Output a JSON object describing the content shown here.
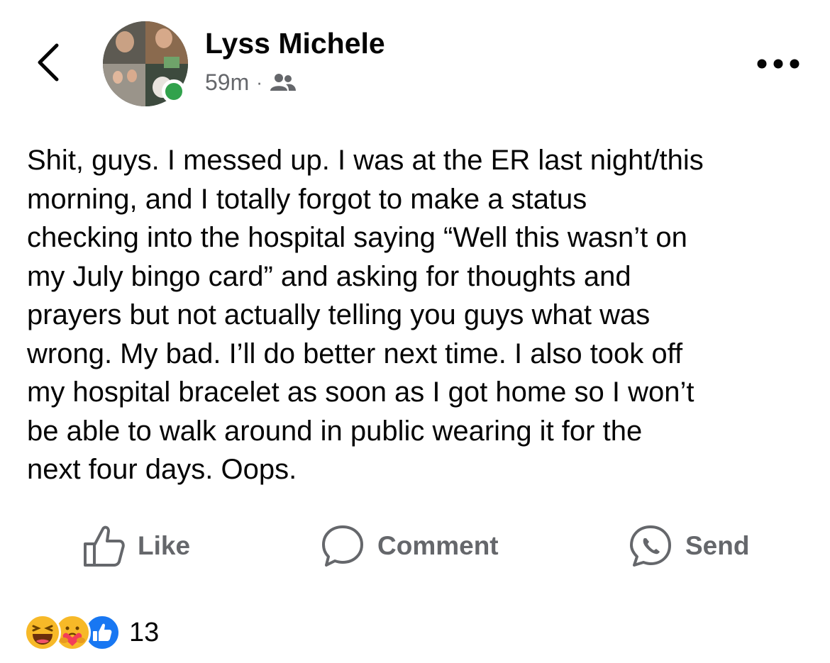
{
  "post": {
    "author": "Lyss Michele",
    "time": "59m",
    "separator": "·",
    "audience_icon": "friends-icon",
    "online_status": "online",
    "text": "Shit, guys. I messed up. I was at the ER last night/this\nmorning, and I totally forgot to make a status\nchecking into the hospital saying “Well this wasn’t on\nmy July bingo card” and asking for thoughts and\nprayers but not actually telling you guys what was\nwrong. My bad. I’ll do better next time. I also took off\nmy hospital bracelet as soon as I got home so I won’t\nbe able to walk around in public wearing it for the\nnext four days. Oops."
  },
  "actions": {
    "like": "Like",
    "comment": "Comment",
    "send": "Send"
  },
  "reactions": {
    "types": [
      "haha",
      "care",
      "like"
    ],
    "count": "13"
  },
  "colors": {
    "text": "#050505",
    "secondary": "#65676b",
    "online": "#31a24c",
    "like_blue": "#1877f2",
    "haha_yellow": "#f7b928"
  },
  "icons": {
    "back": "back-chevron-icon",
    "more": "more-options-icon",
    "like": "thumbs-up-icon",
    "comment": "comment-bubble-icon",
    "send": "messenger-icon"
  }
}
